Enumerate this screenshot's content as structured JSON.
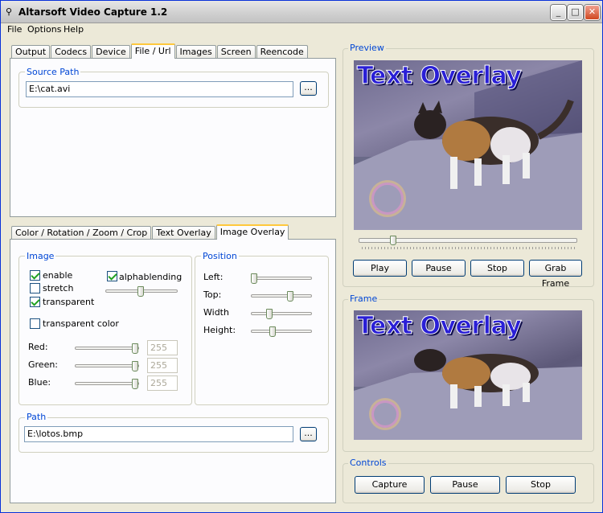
{
  "window": {
    "title": "Altarsoft Video Capture 1.2",
    "icon": "app-icon",
    "min": "_",
    "max": "□",
    "close": "✕"
  },
  "menu": {
    "items": [
      "File",
      "Options",
      "Help"
    ]
  },
  "top_tabs": {
    "items": [
      "Output",
      "Codecs",
      "Device",
      "File / Url",
      "Images",
      "Screen",
      "Reencode"
    ],
    "active": "File / Url"
  },
  "source": {
    "legend": "Source Path",
    "value": "E:\\cat.avi",
    "browse": "..."
  },
  "bottom_tabs": {
    "items": [
      "Color / Rotation / Zoom / Crop",
      "Text Overlay",
      "Image Overlay"
    ],
    "active": "Image Overlay"
  },
  "image_group": {
    "legend": "Image",
    "enable": {
      "label": "enable",
      "checked": true
    },
    "alphablending": {
      "label": "alphablending",
      "checked": true
    },
    "stretch": {
      "label": "stretch",
      "checked": false
    },
    "transparent": {
      "label": "transparent",
      "checked": true
    },
    "transparent_color": {
      "label": "transparent color",
      "checked": false
    },
    "red": {
      "label": "Red:",
      "value": "255"
    },
    "green": {
      "label": "Green:",
      "value": "255"
    },
    "blue": {
      "label": "Blue:",
      "value": "255"
    }
  },
  "position_group": {
    "legend": "Position",
    "left": "Left:",
    "top": "Top:",
    "width": "Width",
    "height": "Height:"
  },
  "path_group": {
    "legend": "Path",
    "value": "E:\\lotos.bmp",
    "browse": "..."
  },
  "preview": {
    "legend": "Preview",
    "overlay_text": "Text Overlay",
    "buttons": {
      "play": "Play",
      "pause": "Pause",
      "stop": "Stop",
      "grab": "Grab Frame"
    }
  },
  "frame": {
    "legend": "Frame",
    "overlay_text": "Text Overlay"
  },
  "controls": {
    "legend": "Controls",
    "capture": "Capture",
    "pause": "Pause",
    "stop": "Stop"
  }
}
